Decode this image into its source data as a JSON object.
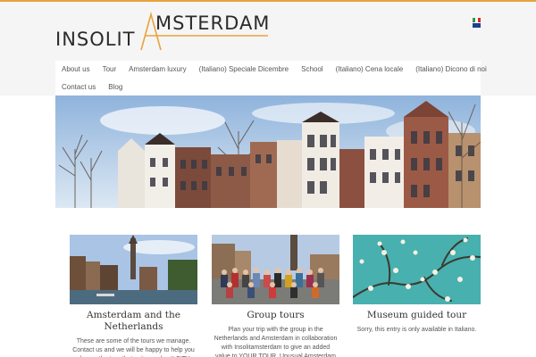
{
  "logo": {
    "left": "INSOLIT",
    "right": "MSTERDAM",
    "a": "A",
    "accent": "#e8a33d"
  },
  "flags": {
    "italian": "italian-flag-icon",
    "english": "uk-flag-icon"
  },
  "nav": {
    "items": [
      "About us",
      "Tour",
      "Amsterdam luxury",
      "(Italiano) Speciale Dicembre",
      "School",
      "(Italiano) Cena locale",
      "(Italiano) Dicono di noi",
      "Contact us",
      "Blog"
    ]
  },
  "cards": [
    {
      "title_l1": "Amsterdam and the",
      "title_l2": "Netherlands",
      "text": "These are some of the tours we manage. Contact us and we will be happy to help you choose the tour that suits you best! CITY TOUR"
    },
    {
      "title_l1": "Group tours",
      "title_l2": "",
      "text": "Plan your trip with the group in the Netherlands and Amsterdam in collaboration with Insolitamsterdam to give an added value to YOUR TOUR. Unusual Amsterdam plans and performs a"
    },
    {
      "title_l1": "Museum guided tour",
      "title_l2": "",
      "text": "Sorry, this entry is only available in Italiano."
    }
  ],
  "colors": {
    "accent": "#e8a33d",
    "header_bg": "#f5f5f5",
    "text": "#444444"
  }
}
